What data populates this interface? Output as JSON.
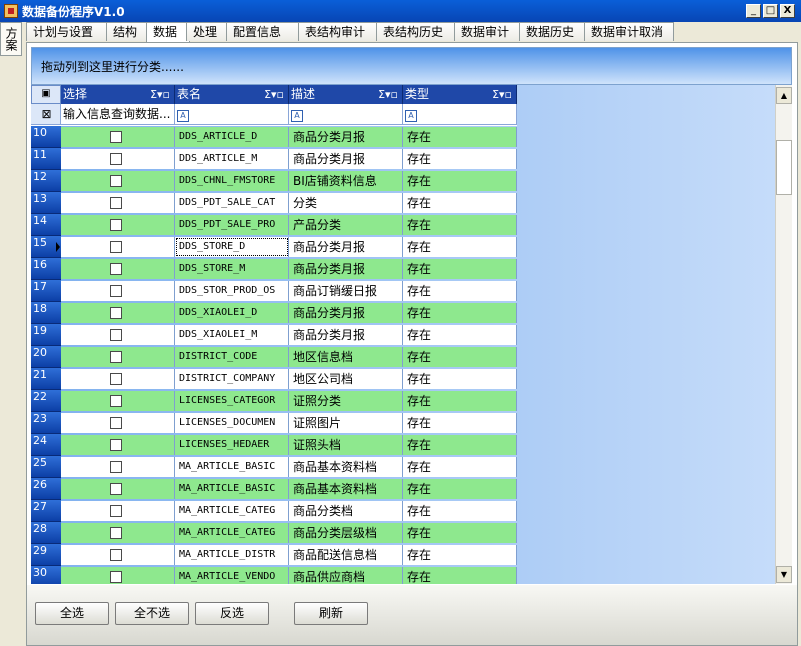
{
  "window": {
    "title": "数据备份程序V1.0",
    "minimize": "_",
    "maximize": "□",
    "close": "X"
  },
  "side_tab": "方案",
  "tabs": [
    "计划与设置",
    "结构",
    "数据",
    "处理",
    "配置信息",
    "表结构审计",
    "表结构历史",
    "数据审计",
    "数据历史",
    "数据审计取消"
  ],
  "active_tab": 2,
  "group_prompt": "拖动列到这里进行分类......",
  "columns": [
    "选择",
    "表名",
    "描述",
    "类型"
  ],
  "header_sigma": "Σ▾▫",
  "filter_placeholder": "输入信息查询数据...",
  "filter_icon": "A",
  "rows": [
    {
      "no": "10",
      "name": "DDS_ARTICLE_D",
      "desc": "商品分类月报",
      "type": "存在"
    },
    {
      "no": "11",
      "name": "DDS_ARTICLE_M",
      "desc": "商品分类月报",
      "type": "存在"
    },
    {
      "no": "12",
      "name": "DDS_CHNL_FMSTORE",
      "desc": "BI店铺资料信息",
      "type": "存在"
    },
    {
      "no": "13",
      "name": "DDS_PDT_SALE_CAT",
      "desc": "分类",
      "type": "存在"
    },
    {
      "no": "14",
      "name": "DDS_PDT_SALE_PRO",
      "desc": "产品分类",
      "type": "存在"
    },
    {
      "no": "15",
      "name": "DDS_STORE_D",
      "desc": "商品分类月报",
      "type": "存在"
    },
    {
      "no": "16",
      "name": "DDS_STORE_M",
      "desc": "商品分类月报",
      "type": "存在"
    },
    {
      "no": "17",
      "name": "DDS_STOR_PROD_OS",
      "desc": "商品订销缓日报",
      "type": "存在"
    },
    {
      "no": "18",
      "name": "DDS_XIAOLEI_D",
      "desc": "商品分类月报",
      "type": "存在"
    },
    {
      "no": "19",
      "name": "DDS_XIAOLEI_M",
      "desc": "商品分类月报",
      "type": "存在"
    },
    {
      "no": "20",
      "name": "DISTRICT_CODE",
      "desc": "地区信息档",
      "type": "存在"
    },
    {
      "no": "21",
      "name": "DISTRICT_COMPANY",
      "desc": "地区公司档",
      "type": "存在"
    },
    {
      "no": "22",
      "name": "LICENSES_CATEGOR",
      "desc": "证照分类",
      "type": "存在"
    },
    {
      "no": "23",
      "name": "LICENSES_DOCUMEN",
      "desc": "证照图片",
      "type": "存在"
    },
    {
      "no": "24",
      "name": "LICENSES_HEDAER",
      "desc": "证照头档",
      "type": "存在"
    },
    {
      "no": "25",
      "name": "MA_ARTICLE_BASIC",
      "desc": "商品基本资料档",
      "type": "存在"
    },
    {
      "no": "26",
      "name": "MA_ARTICLE_BASIC",
      "desc": "商品基本资料档",
      "type": "存在"
    },
    {
      "no": "27",
      "name": "MA_ARTICLE_CATEG",
      "desc": "商品分类档",
      "type": "存在"
    },
    {
      "no": "28",
      "name": "MA_ARTICLE_CATEG",
      "desc": "商品分类层级档",
      "type": "存在"
    },
    {
      "no": "29",
      "name": "MA_ARTICLE_DISTR",
      "desc": "商品配送信息档",
      "type": "存在"
    },
    {
      "no": "30",
      "name": "MA_ARTICLE_VENDO",
      "desc": "商品供应商档",
      "type": "存在"
    }
  ],
  "current_row": 5,
  "colors": {
    "row_green": "#8ee88e",
    "row_white": "#ffffff",
    "header": "#1f48a8"
  },
  "buttons": {
    "select_all": "全选",
    "select_none": "全不选",
    "invert": "反选",
    "refresh": "刷新"
  }
}
